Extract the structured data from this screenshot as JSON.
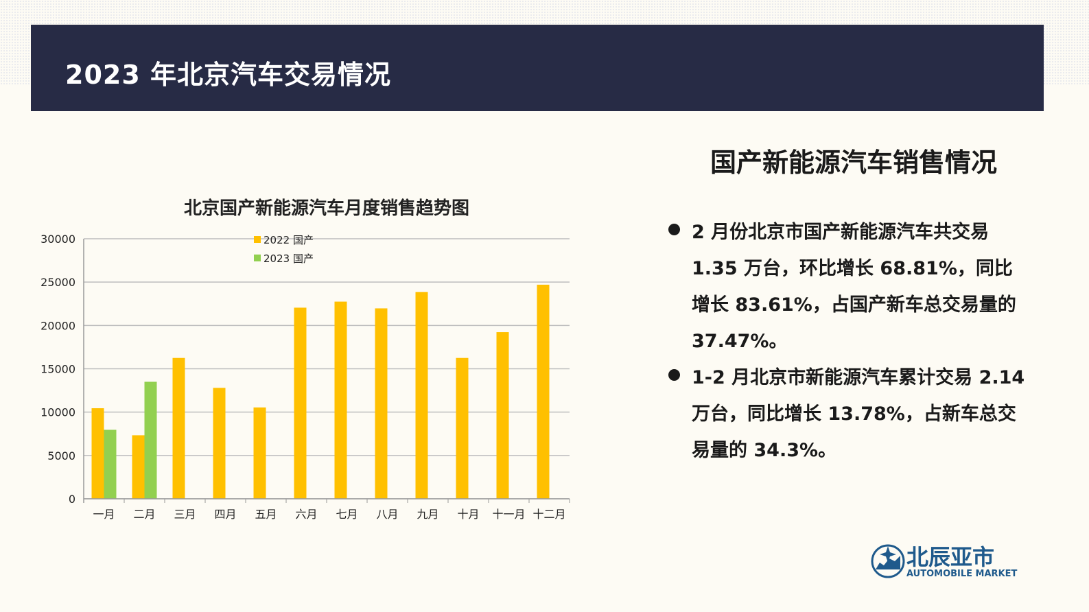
{
  "header": {
    "title": "2023 年北京汽车交易情况"
  },
  "side": {
    "title": "国产新能源汽车销售情况",
    "bullets": [
      "2 月份北京市国产新能源汽车共交易 1.35 万台，环比增长 68.81%，同比增长 83.61%，占国产新车总交易量的 37.47%。",
      "1-2 月北京市新能源汽车累计交易 2.14 万台，同比增长 13.78%，占新车总交易量的 34.3%。"
    ]
  },
  "logo": {
    "cn": "北辰亚市",
    "en": "AUTOMOBILE MARKET",
    "color": "#1f5a8c"
  },
  "chart_data": {
    "type": "bar",
    "title": "北京国产新能源汽车月度销售趋势图",
    "xlabel": "",
    "ylabel": "",
    "ylim": [
      0,
      30000
    ],
    "yticks": [
      0,
      5000,
      10000,
      15000,
      20000,
      25000,
      30000
    ],
    "grid": true,
    "legend_position": "top-center",
    "categories": [
      "一月",
      "二月",
      "三月",
      "四月",
      "五月",
      "六月",
      "七月",
      "八月",
      "九月",
      "十月",
      "十一月",
      "十二月"
    ],
    "series": [
      {
        "name": "2022 国产",
        "color": "#ffc000",
        "values": [
          10450,
          7330,
          16250,
          12800,
          10540,
          22050,
          22750,
          21970,
          23850,
          16250,
          19230,
          24700
        ]
      },
      {
        "name": "2023 国产",
        "color": "#92d050",
        "values": [
          7960,
          13500,
          null,
          null,
          null,
          null,
          null,
          null,
          null,
          null,
          null,
          null
        ]
      }
    ]
  }
}
